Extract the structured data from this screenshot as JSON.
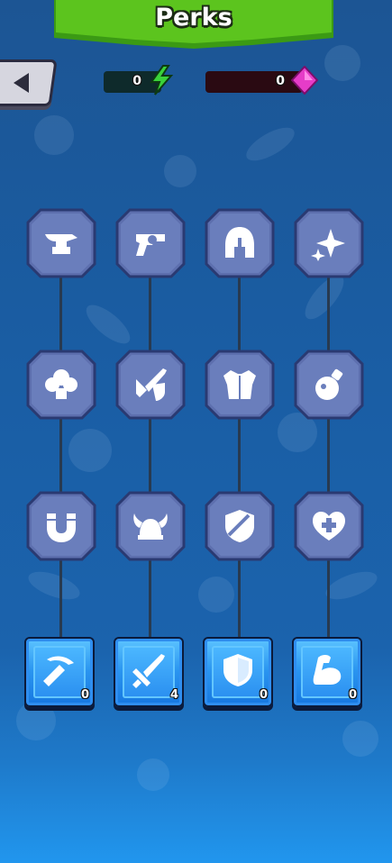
{
  "header": {
    "title": "Perks"
  },
  "resources": {
    "energy": "0",
    "gems": "0"
  },
  "colors": {
    "banner": "#5cc41e",
    "energy": "#3ad23a",
    "gem": "#e63cc8",
    "locked_tile": "#5d6fae",
    "stat_tile": "#2a95f0"
  },
  "perks": [
    {
      "icon": "anvil-icon"
    },
    {
      "icon": "revolver-icon"
    },
    {
      "icon": "spartan-helmet-icon"
    },
    {
      "icon": "sparkle-icon"
    },
    {
      "icon": "cloud-icon"
    },
    {
      "icon": "sword-shield-icon"
    },
    {
      "icon": "armor-icon"
    },
    {
      "icon": "potion-icon"
    },
    {
      "icon": "magnet-icon"
    },
    {
      "icon": "viking-helmet-icon"
    },
    {
      "icon": "shield-sword-icon"
    },
    {
      "icon": "heart-plus-icon"
    }
  ],
  "stats": [
    {
      "icon": "pickaxe-icon",
      "count": "0"
    },
    {
      "icon": "sword-icon",
      "count": "4"
    },
    {
      "icon": "shield-icon",
      "count": "0"
    },
    {
      "icon": "flexed-arm-icon",
      "count": "0"
    }
  ]
}
